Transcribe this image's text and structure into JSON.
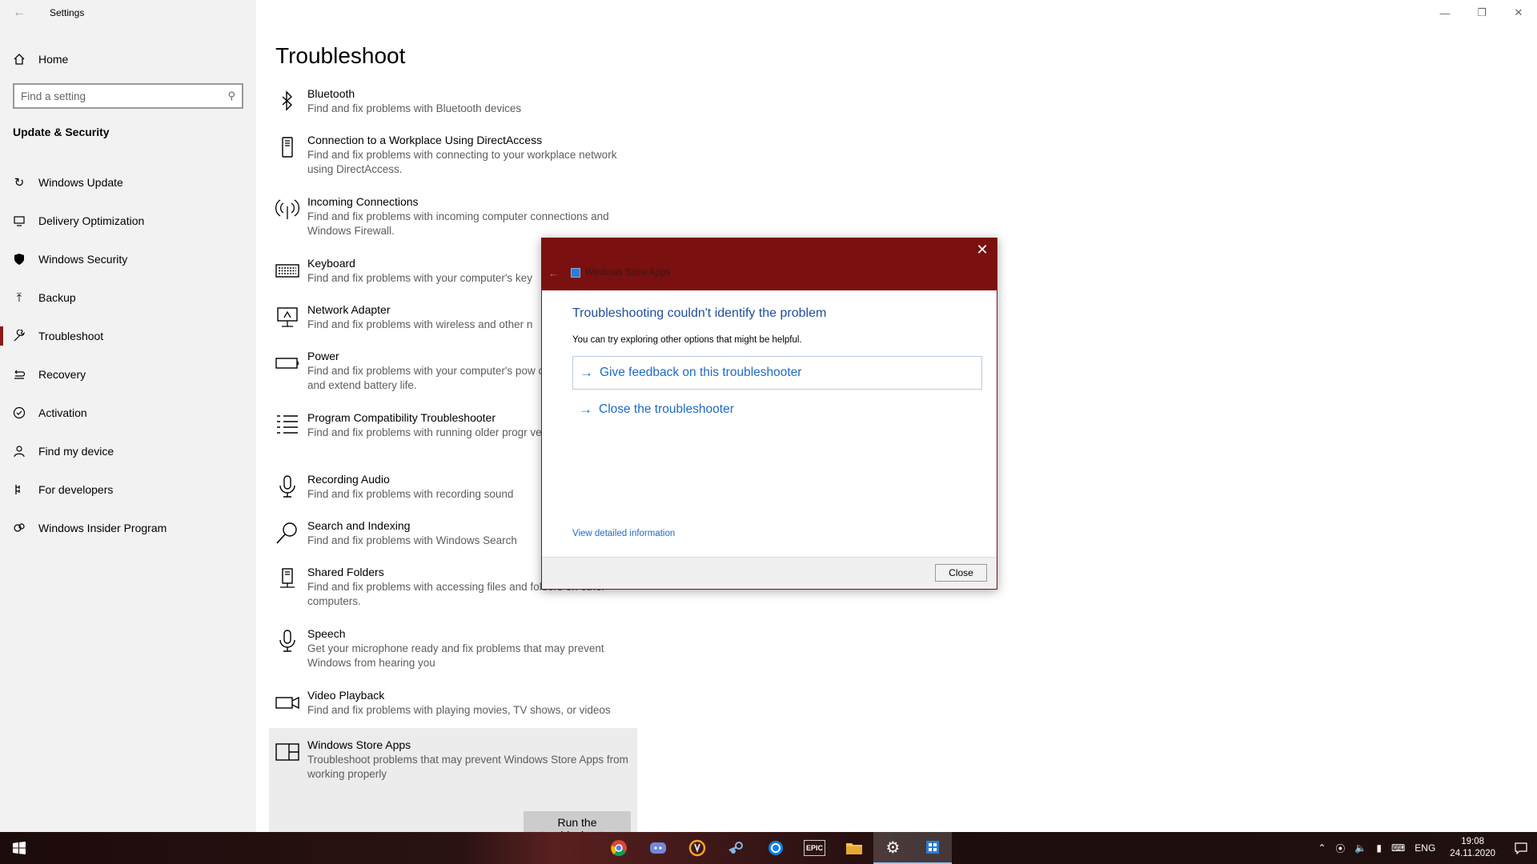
{
  "window": {
    "title": "Settings",
    "controls": [
      "—",
      "❐",
      "✕"
    ]
  },
  "sidebar": {
    "home_label": "Home",
    "search_placeholder": "Find a setting",
    "section_title": "Update & Security",
    "items": [
      {
        "label": "Windows Update",
        "icon": "sync-icon",
        "active": false
      },
      {
        "label": "Delivery Optimization",
        "icon": "delivery-optimization-icon",
        "active": false
      },
      {
        "label": "Windows Security",
        "icon": "shield-icon",
        "active": false
      },
      {
        "label": "Backup",
        "icon": "backup-arrow-icon",
        "active": false
      },
      {
        "label": "Troubleshoot",
        "icon": "wrench-icon",
        "active": true
      },
      {
        "label": "Recovery",
        "icon": "recovery-icon",
        "active": false
      },
      {
        "label": "Activation",
        "icon": "check-circle-icon",
        "active": false
      },
      {
        "label": "Find my device",
        "icon": "person-pin-icon",
        "active": false
      },
      {
        "label": "For developers",
        "icon": "developer-icon",
        "active": false
      },
      {
        "label": "Windows Insider Program",
        "icon": "insider-icon",
        "active": false
      }
    ]
  },
  "main": {
    "title": "Troubleshoot",
    "troubleshooters": [
      {
        "name": "Bluetooth",
        "desc": "Find and fix problems with Bluetooth devices",
        "icon": "bluetooth-icon"
      },
      {
        "name": "Connection to a Workplace Using DirectAccess",
        "desc": "Find and fix problems with connecting to your workplace network using DirectAccess.",
        "icon": "phone-device-icon"
      },
      {
        "name": "Incoming Connections",
        "desc": "Find and fix problems with incoming computer connections and Windows Firewall.",
        "icon": "antenna-icon"
      },
      {
        "name": "Keyboard",
        "desc": "Find and fix problems with your computer's key",
        "icon": "keyboard-icon"
      },
      {
        "name": "Network Adapter",
        "desc": "Find and fix problems with wireless and other n",
        "icon": "network-monitor-icon"
      },
      {
        "name": "Power",
        "desc": "Find and fix problems with your computer's pow conserve power and extend battery life.",
        "icon": "battery-icon"
      },
      {
        "name": "Program Compatibility Troubleshooter",
        "desc": "Find and fix problems with running older progr version of Windows.",
        "icon": "list-icon"
      },
      {
        "name": "Recording Audio",
        "desc": "Find and fix problems with recording sound",
        "icon": "microphone-icon"
      },
      {
        "name": "Search and Indexing",
        "desc": "Find and fix problems with Windows Search",
        "icon": "search-icon"
      },
      {
        "name": "Shared Folders",
        "desc": "Find and fix problems with accessing files and folders on other computers.",
        "icon": "server-icon"
      },
      {
        "name": "Speech",
        "desc": "Get your microphone ready and fix problems that may prevent Windows from hearing you",
        "icon": "microphone-icon"
      },
      {
        "name": "Video Playback",
        "desc": "Find and fix problems with playing movies, TV shows, or videos",
        "icon": "video-camera-icon"
      }
    ],
    "selected": {
      "name": "Windows Store Apps",
      "desc": "Troubleshoot problems that may prevent Windows Store Apps from working properly",
      "icon": "store-apps-icon",
      "run_label": "Run the troubleshooter"
    }
  },
  "dialog": {
    "app_title": "Windows Store Apps",
    "heading": "Troubleshooting couldn't identify the problem",
    "subtext": "You can try exploring other options that might be helpful.",
    "option_feedback": "Give feedback on this troubleshooter",
    "option_close": "Close the troubleshooter",
    "detail_link": "View detailed information",
    "close_button": "Close",
    "accent_color": "#7a1010"
  },
  "taskbar": {
    "apps": [
      "chrome-icon",
      "discord-icon",
      "overwatch-icon",
      "steam-icon",
      "uplay-icon",
      "epic-games-icon",
      "file-explorer-icon",
      "settings-gear-icon",
      "store-apps-icon"
    ],
    "epic_label": "EPIC",
    "language": "ENG",
    "time": "19:08",
    "date": "24.11.2020"
  }
}
